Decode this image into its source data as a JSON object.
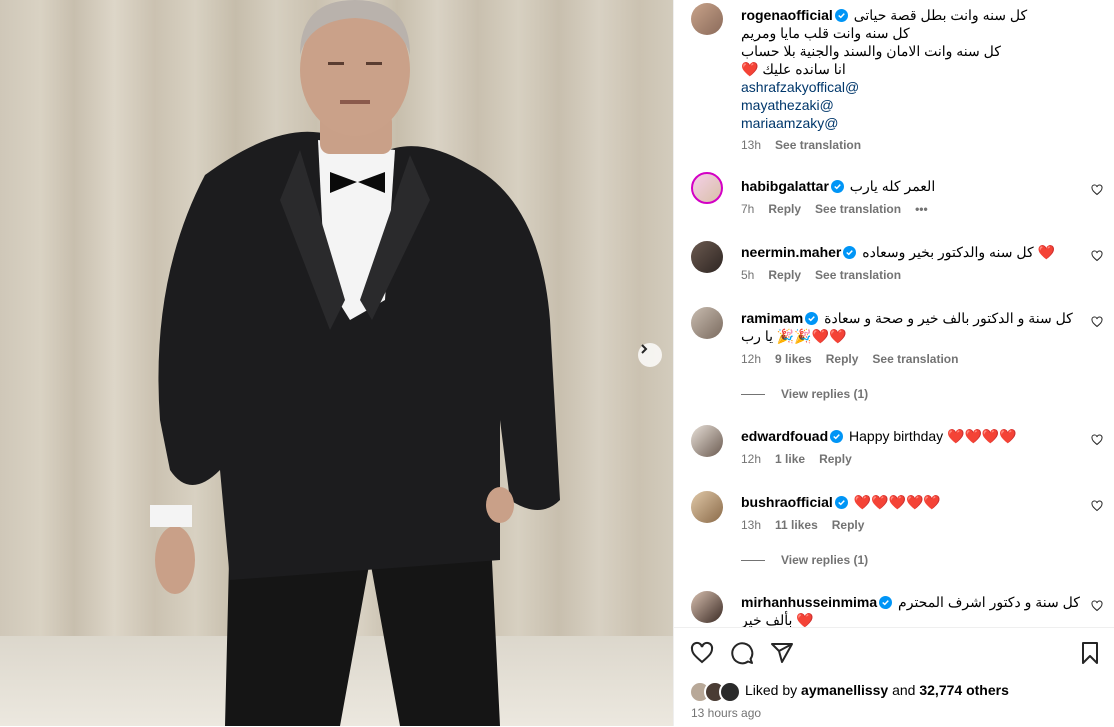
{
  "post": {
    "author": "rogenaofficial",
    "caption_lines": [
      "كل سنه وانت بطل قصة حياتى",
      "كل سنه وانت قلب مايا ومريم",
      "كل سنه وانت الامان والسند والجنية بلا حساب",
      "انا سانده عليك ❤️"
    ],
    "mentions": [
      "ashrafzakyoffical@",
      "mayathezaki@",
      "mariaamzaky@"
    ],
    "time": "13h",
    "see_translation": "See translation"
  },
  "comments": [
    {
      "user": "habibgalattar",
      "verified": true,
      "text": "العمر كله يارب",
      "time": "7h",
      "likes": "",
      "reply": "Reply",
      "translate": "See translation",
      "more": "•••"
    },
    {
      "user": "neermin.maher",
      "verified": true,
      "text": "كل سنه والدكتور بخير وسعاده ❤️",
      "time": "5h",
      "likes": "",
      "reply": "Reply",
      "translate": "See translation"
    },
    {
      "user": "ramimam",
      "verified": true,
      "text": "كل سنة و الدكتور بالف خير و صحة و سعادة",
      "text2": "يا رب 🎉🎉❤️❤️",
      "time": "12h",
      "likes": "9 likes",
      "reply": "Reply",
      "translate": "See translation",
      "view_replies": "View replies (1)"
    },
    {
      "user": "edwardfouad",
      "verified": true,
      "text": "Happy birthday ❤️❤️❤️❤️",
      "time": "12h",
      "likes": "1 like",
      "reply": "Reply"
    },
    {
      "user": "bushraofficial",
      "verified": true,
      "text": "❤️❤️❤️❤️❤️",
      "time": "13h",
      "likes": "11 likes",
      "reply": "Reply",
      "view_replies": "View replies (1)"
    },
    {
      "user": "mirhanhusseinmima",
      "verified": true,
      "text": "كل سنة و دكتور اشرف المحترم",
      "text2": "بألف خير ❤️"
    }
  ],
  "footer": {
    "liked_by_prefix": "Liked by",
    "liked_by_user": "aymanellissy",
    "liked_by_middle": "and",
    "liked_by_count": "32,774 others",
    "timestamp": "13 hours ago"
  },
  "colors": {
    "verified": "#0095f6",
    "heart": "#ed1c24",
    "muted": "#737373"
  }
}
